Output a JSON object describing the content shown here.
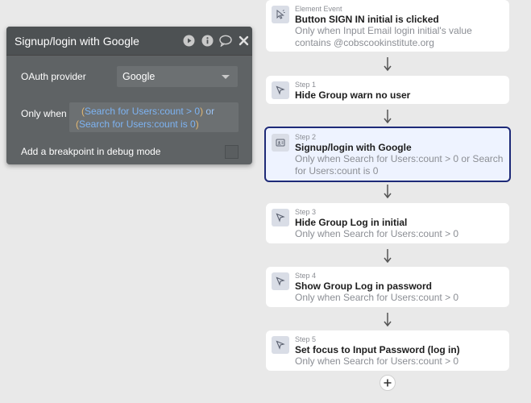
{
  "panel": {
    "title": "Signup/login with Google",
    "oauth_label": "OAuth provider",
    "oauth_value": "Google",
    "only_when_label": "Only when",
    "condition": {
      "open1": "(",
      "expr1": "Search for Users:count > 0",
      "close1": ")",
      "or": "or",
      "open2": "(",
      "expr2": "Search for Users:count is 0",
      "close2": ")"
    },
    "breakpoint_label": "Add a breakpoint in debug mode",
    "icons": [
      "play-icon",
      "info-icon",
      "comment-icon",
      "close-icon"
    ]
  },
  "workflow": {
    "event": {
      "step_label": "Element Event",
      "title": "Button SIGN IN initial is clicked",
      "condition": "Only when Input Email login initial's value contains @cobscookinstitute.org"
    },
    "steps": [
      {
        "step_label": "Step 1",
        "title": "Hide Group warn no user",
        "condition": ""
      },
      {
        "step_label": "Step 2",
        "title": "Signup/login with Google",
        "condition": "Only when Search for Users:count > 0 or Search for Users:count is 0"
      },
      {
        "step_label": "Step 3",
        "title": "Hide Group Log in initial",
        "condition": "Only when Search for Users:count > 0"
      },
      {
        "step_label": "Step 4",
        "title": "Show Group Log in password",
        "condition": "Only when Search for Users:count > 0"
      },
      {
        "step_label": "Step 5",
        "title": "Set focus to Input Password (log in)",
        "condition": "Only when Search for Users:count > 0"
      }
    ],
    "selected_step": "Step 2"
  },
  "colors": {
    "panel_bg": "#5f6365",
    "expression_blue": "#7db3f2",
    "paren_orange": "#e3b873",
    "selected_border": "#1e2a78"
  }
}
